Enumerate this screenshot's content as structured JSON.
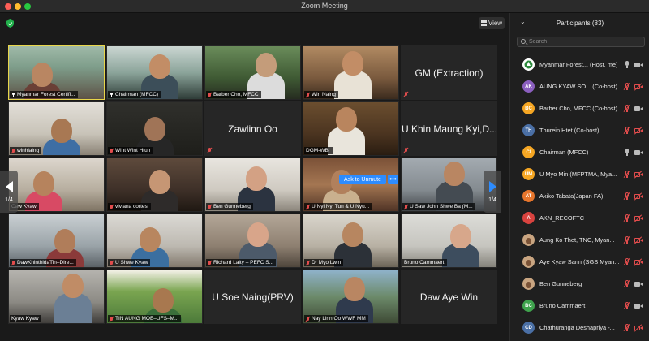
{
  "window": {
    "title": "Zoom Meeting"
  },
  "toolbar": {
    "view_label": "View",
    "view_icon": "grid-icon",
    "security_icon": "shield-icon"
  },
  "gallery": {
    "page_left": "1/4",
    "page_right": "1/4",
    "ask_to_unmute": "Ask to Unmute",
    "more_label": "•••",
    "tiles": [
      {
        "name": "Myanmar Forest Certifi...",
        "video": true,
        "pinned": true,
        "active": true
      },
      {
        "name": "Chairman (MFCC)",
        "video": true,
        "pinned": true
      },
      {
        "name": "Barber Cho, MFCC",
        "video": true,
        "muted": true
      },
      {
        "name": "Win Naing",
        "video": true,
        "muted": true
      },
      {
        "name": "GM (Extraction)",
        "video": false,
        "muted": true
      },
      {
        "name": "winhlaing",
        "video": true,
        "muted": true
      },
      {
        "name": "Wint Wint Htun",
        "video": true,
        "muted": true
      },
      {
        "name": "Zawlinn Oo",
        "video": false,
        "muted": true
      },
      {
        "name": "DGM-WBI",
        "video": true
      },
      {
        "name": "U Khin Maung Kyi,D...",
        "video": false,
        "muted": true
      },
      {
        "name": "Caw Kyaw",
        "video": true
      },
      {
        "name": "viviana cortesi",
        "video": true,
        "muted": true
      },
      {
        "name": "Ben Gunneberg",
        "video": true,
        "muted": true
      },
      {
        "name": "U Nyi Nyi Tun & U Nyu...",
        "video": true,
        "muted": true
      },
      {
        "name": "U Saw John Shwe Ba (M...",
        "video": true,
        "muted": true
      },
      {
        "name": "DawKhinthidaTin–Dire...",
        "video": true,
        "muted": true
      },
      {
        "name": "U Shwe Kyaw",
        "video": true,
        "muted": true
      },
      {
        "name": "Richard Laity – PEFC S...",
        "video": true,
        "muted": true
      },
      {
        "name": "Dr Myo Lwin",
        "video": true,
        "muted": true
      },
      {
        "name": "Bruno Cammaert",
        "video": true
      },
      {
        "name": "Kyaw Kyaw",
        "video": true
      },
      {
        "name": "TIN AUNG MOE–UFS–M...",
        "video": true,
        "muted": true
      },
      {
        "name": "U Soe Naing(PRV)",
        "video": false
      },
      {
        "name": "Nay Linn Oo WWF MM",
        "video": true,
        "muted": true
      },
      {
        "name": "Daw Aye Win",
        "video": false
      }
    ]
  },
  "participants_panel": {
    "title": "Participants (83)",
    "collapse_icon": "chevron-down-icon",
    "search_placeholder": "Search",
    "items": [
      {
        "name": "Myanmar Forest... (Host, me)",
        "avatar": "",
        "color": "#ffffff",
        "type": "logo",
        "mic": "on",
        "cam": "on"
      },
      {
        "name": "AUNG KYAW SO... (Co-host)",
        "avatar": "AK",
        "color": "#8b5fbf",
        "mic": "off",
        "cam": "off"
      },
      {
        "name": "Barber Cho, MFCC (Co-host)",
        "avatar": "BC",
        "color": "#f5a623",
        "mic": "off",
        "cam": "on"
      },
      {
        "name": "Thurein Htet (Co-host)",
        "avatar": "TH",
        "color": "#4a6fa5",
        "mic": "off",
        "cam": "off"
      },
      {
        "name": "Chairman (MFCC)",
        "avatar": "CI",
        "color": "#f5a623",
        "mic": "on",
        "cam": "on"
      },
      {
        "name": "U Myo Min (MFPTMA, Mya...",
        "avatar": "UM",
        "color": "#f5a623",
        "mic": "off",
        "cam": "off"
      },
      {
        "name": "Akiko Tabata(Japan FA)",
        "avatar": "AT",
        "color": "#e8762c",
        "mic": "off",
        "cam": "off"
      },
      {
        "name": "AKN_RECOFTC",
        "avatar": "A",
        "color": "#d9433f",
        "mic": "off",
        "cam": "off"
      },
      {
        "name": "Aung Ko Thet, TNC, Myan...",
        "avatar": "",
        "color": "#c9a581",
        "type": "photo",
        "mic": "off",
        "cam": "off"
      },
      {
        "name": "Aye Kyaw Sann (SGS Myan...",
        "avatar": "",
        "color": "#c9a581",
        "type": "photo",
        "mic": "off",
        "cam": "off"
      },
      {
        "name": "Ben Gunneberg",
        "avatar": "",
        "color": "#c9a581",
        "type": "photo",
        "mic": "off",
        "cam": "on"
      },
      {
        "name": "Bruno Cammaert",
        "avatar": "BC",
        "color": "#3fa34d",
        "mic": "off",
        "cam": "on"
      },
      {
        "name": "Chathuranga Deshapriya -...",
        "avatar": "CD",
        "color": "#4a6fa5",
        "mic": "off",
        "cam": "off"
      }
    ]
  },
  "colors": {
    "accent": "#2d8cff",
    "muted": "#e34d4d",
    "active_speaker": "#e8d64a"
  }
}
